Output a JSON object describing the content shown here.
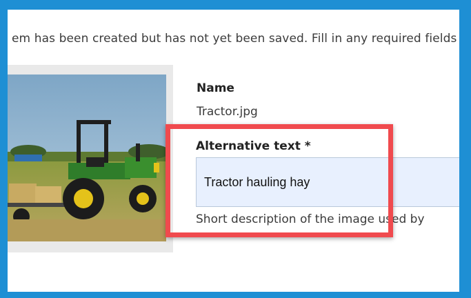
{
  "status_message": "em has been created but has not yet been saved. Fill in any required fields",
  "image": {
    "alt_hint": "tractor-photo"
  },
  "name_field": {
    "label": "Name",
    "value": "Tractor.jpg"
  },
  "alt_field": {
    "label": "Alternative text *",
    "value": "Tractor hauling hay",
    "help": "Short description of the image used by"
  },
  "colors": {
    "frame": "#1e8fd4",
    "highlight": "#f04a4e",
    "input_bg": "#e8f0fe"
  }
}
